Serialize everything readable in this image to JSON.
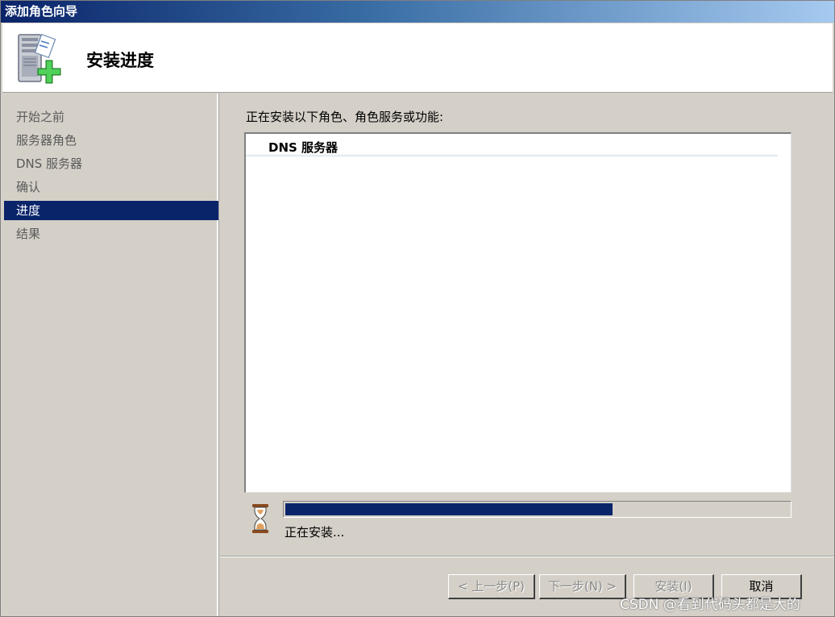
{
  "window": {
    "title": "添加角色向导"
  },
  "header": {
    "title": "安装进度",
    "icon": "server-add-icon"
  },
  "sidebar": {
    "items": [
      {
        "label": "开始之前",
        "active": false
      },
      {
        "label": "服务器角色",
        "active": false
      },
      {
        "label": "DNS 服务器",
        "active": false
      },
      {
        "label": "确认",
        "active": false
      },
      {
        "label": "进度",
        "active": true
      },
      {
        "label": "结果",
        "active": false
      }
    ]
  },
  "main": {
    "intro": "正在安装以下角色、角色服务或功能:",
    "list": [
      "DNS 服务器"
    ],
    "progress_fraction": 0.65,
    "status": "正在安装..."
  },
  "buttons": {
    "prev": "< 上一步(P)",
    "next": "下一步(N) >",
    "install": "安装(I)",
    "cancel": "取消"
  },
  "watermark": "CSDN @看到代码头都是大的",
  "colors": {
    "selection": "#0a246a",
    "window_bg": "#d4d0c8",
    "accent_green": "#3cb043"
  }
}
